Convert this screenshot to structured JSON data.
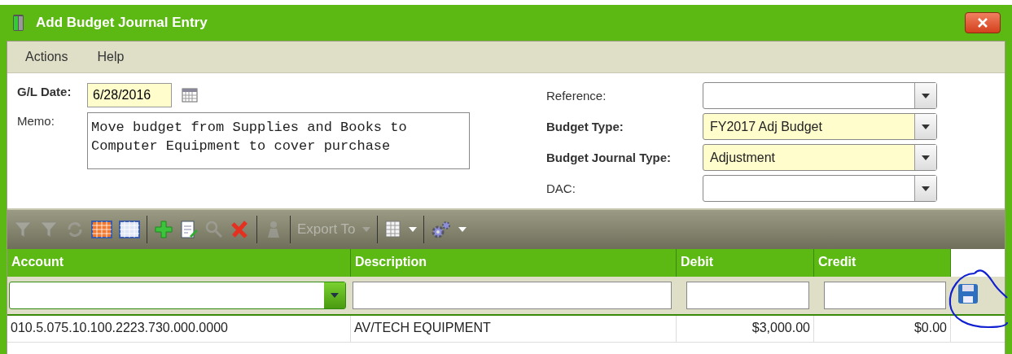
{
  "window": {
    "title": "Add Budget Journal Entry"
  },
  "menu": [
    "Actions",
    "Help"
  ],
  "left_fields": [
    {
      "label": "G/L Date:",
      "value": "6/28/2016",
      "kind": "date",
      "required": true
    },
    {
      "label": "Memo:",
      "value": "Move budget from Supplies and Books to Computer Equipment to cover purchase",
      "kind": "memo",
      "required": false
    }
  ],
  "right_fields": [
    {
      "label": "Reference:",
      "kind": "dropdown",
      "required": false
    },
    {
      "label": "Budget Type:",
      "value": "FY2017 Adj Budget",
      "kind": "dropdown",
      "required": true
    },
    {
      "label": "Budget Journal Type:",
      "value": "Adjustment",
      "kind": "dropdown",
      "required": true
    },
    {
      "label": "DAC:",
      "kind": "dropdown",
      "required": false
    }
  ],
  "toolbar": [
    {
      "kind": "filter",
      "disabled": true
    },
    {
      "kind": "filter",
      "disabled": true
    },
    {
      "kind": "refresh",
      "disabled": true
    },
    {
      "kind": "grid-orange",
      "disabled": false
    },
    {
      "kind": "grid-blue",
      "disabled": false
    },
    {
      "kind": "separator"
    },
    {
      "kind": "add",
      "disabled": false
    },
    {
      "kind": "edit",
      "disabled": false
    },
    {
      "kind": "search",
      "disabled": true
    },
    {
      "kind": "delete",
      "disabled": false
    },
    {
      "kind": "separator"
    },
    {
      "kind": "person",
      "disabled": true
    },
    {
      "kind": "separator"
    },
    {
      "kind": "menu",
      "label": "Export To",
      "disabled": true
    },
    {
      "kind": "separator"
    },
    {
      "kind": "columns-menu",
      "disabled": false
    },
    {
      "kind": "separator"
    },
    {
      "kind": "gear-menu",
      "disabled": false
    }
  ],
  "table": {
    "columns": [
      "Account",
      "Description",
      "Debit",
      "Credit"
    ],
    "rows": [
      [
        "010.5.075.10.100.2223.730.000.0000",
        "AV/TECH EQUIPMENT",
        "$3,000.00",
        "$0.00"
      ]
    ]
  }
}
